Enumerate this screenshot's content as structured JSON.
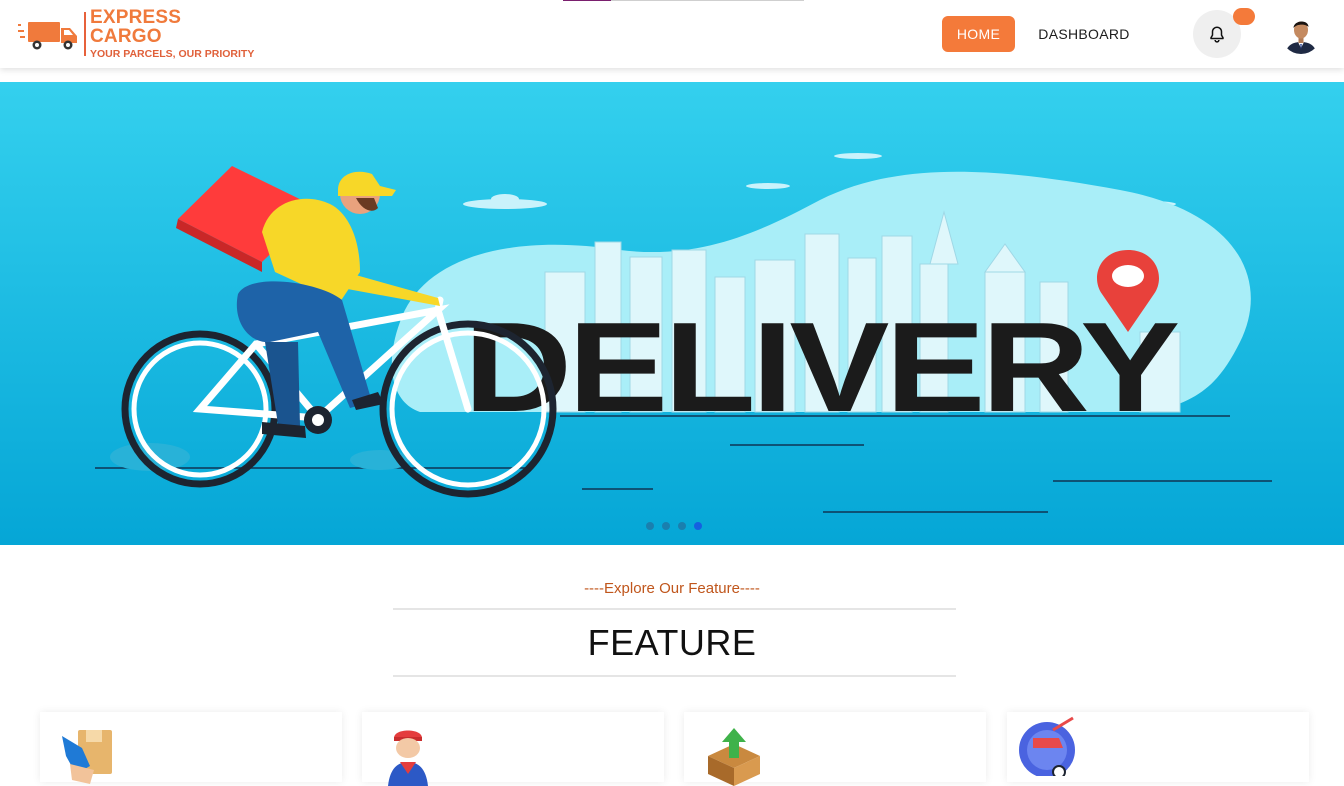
{
  "header": {
    "brand_name": "EXPRESS CARGO",
    "brand_tagline": "YOUR PARCELS, OUR PRIORITY",
    "nav": [
      {
        "label": "HOME",
        "active": true
      },
      {
        "label": "DASHBOARD",
        "active": false
      }
    ],
    "notification_icon": "bell-icon",
    "progress_fraction": 0.2
  },
  "hero": {
    "word": "DELIVERY",
    "slides_total": 4,
    "active_slide": 4
  },
  "features": {
    "eyebrow": "----Explore Our Feature----",
    "title": "FEATURE",
    "cards": [
      {
        "icon": "parcel-hand-icon"
      },
      {
        "icon": "delivery-man-icon"
      },
      {
        "icon": "box-upload-icon"
      },
      {
        "icon": "fast-delivery-icon"
      }
    ]
  },
  "colors": {
    "accent": "#f47a3a",
    "brand_text": "#f07a3c",
    "eyebrow": "#c0561c",
    "hero_sky": "#2fc8ea"
  }
}
